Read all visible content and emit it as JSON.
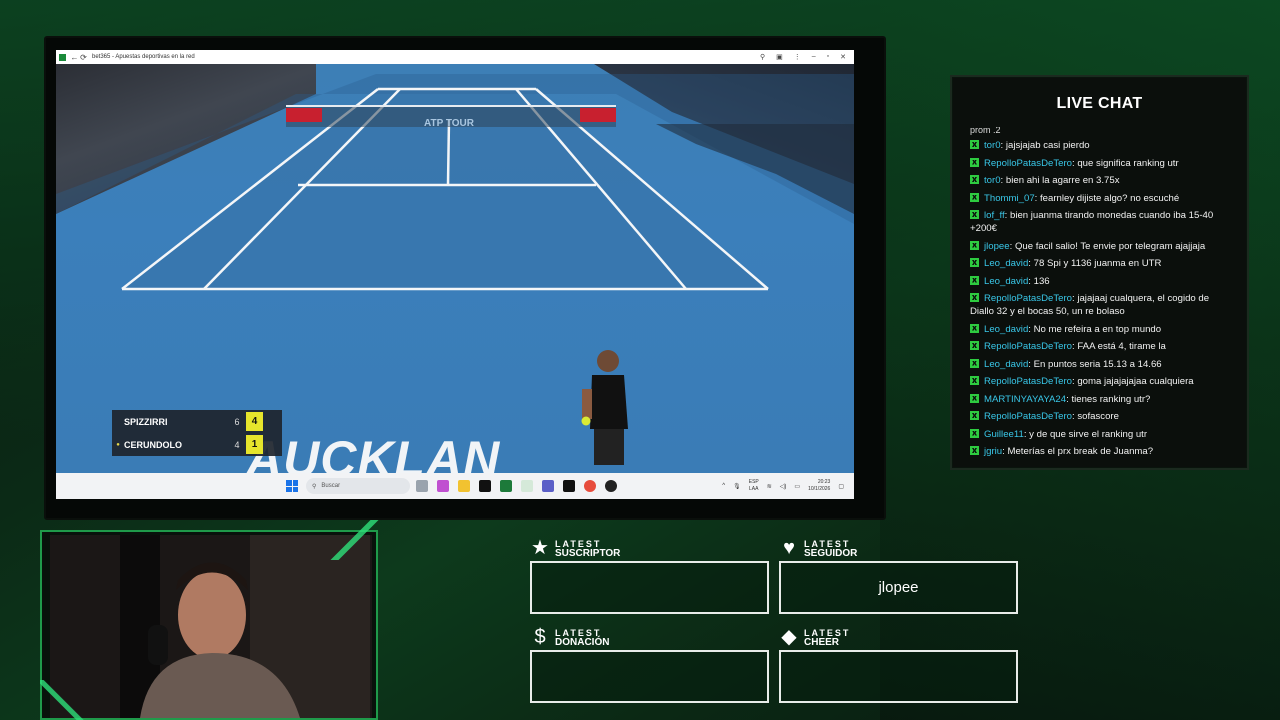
{
  "browser": {
    "title": "bet365 - Apuestas deportivas en la red",
    "taskbar": {
      "search_placeholder": "Buscar",
      "lang_top": "ESP",
      "lang_bottom": "LAA",
      "time": "20:23",
      "date": "10/1/2026"
    }
  },
  "broadcast": {
    "scoreboard": [
      {
        "player": "SPIZZIRRI",
        "set": "6",
        "game": "4",
        "serving": false
      },
      {
        "player": "CERUNDOLO",
        "set": "4",
        "game": "1",
        "serving": true
      }
    ],
    "signage": "AUCKLAN",
    "net_sign": "ATP TOUR"
  },
  "chat": {
    "title": "LIVE CHAT",
    "truncated_top": "prom .2",
    "messages": [
      {
        "user": "tor0",
        "text": "jajsjajab casi pierdo"
      },
      {
        "user": "RepolloPatasDeTero",
        "text": "que significa ranking utr"
      },
      {
        "user": "tor0",
        "text": "bien ahi la agarre en 3.75x"
      },
      {
        "user": "Thommi_07",
        "text": "fearnley dijiste algo? no escuché"
      },
      {
        "user": "lof_ff",
        "text": "bien juanma tirando monedas cuando iba 15-40 +200€"
      },
      {
        "user": "jlopee",
        "text": "Que facil salio! Te envie por telegram ajajjaja"
      },
      {
        "user": "Leo_david",
        "text": "78 Spi y 1136 juanma en UTR"
      },
      {
        "user": "Leo_david",
        "text": "136"
      },
      {
        "user": "RepolloPatasDeTero",
        "text": "jajajaaj cualquera, el cogido de Diallo 32 y el bocas 50, un re bolaso"
      },
      {
        "user": "Leo_david",
        "text": "No me refeira a en top mundo"
      },
      {
        "user": "RepolloPatasDeTero",
        "text": "FAA está 4, tirame la"
      },
      {
        "user": "Leo_david",
        "text": "En puntos seria 15.13 a 14.66"
      },
      {
        "user": "RepolloPatasDeTero",
        "text": "goma jajajajajaa cualquiera"
      },
      {
        "user": "MARTINYAYAYA24",
        "text": "tienes ranking utr?"
      },
      {
        "user": "RepolloPatasDeTero",
        "text": "sofascore"
      },
      {
        "user": "Guillee11",
        "text": "y de que sirve el ranking utr"
      },
      {
        "user": "jgriu",
        "text": "Meterías el prx break de Juanma?"
      }
    ]
  },
  "latest": {
    "suscriptor": {
      "line1": "LATEST",
      "line2": "SUSCRIPTOR",
      "value": "",
      "icon": "star-icon"
    },
    "seguidor": {
      "line1": "LATEST",
      "line2": "SEGUIDOR",
      "value": "jlopee",
      "icon": "heart-icon"
    },
    "donacion": {
      "line1": "LATEST",
      "line2": "DONACIÓN",
      "value": "",
      "icon": "dollar-icon"
    },
    "cheer": {
      "line1": "LATEST",
      "line2": "CHEER",
      "value": "",
      "icon": "diamond-icon"
    }
  },
  "colors": {
    "accent": "#2ecc40",
    "chat_user": "#39c7e8",
    "score_highlight": "#e6e52c"
  }
}
